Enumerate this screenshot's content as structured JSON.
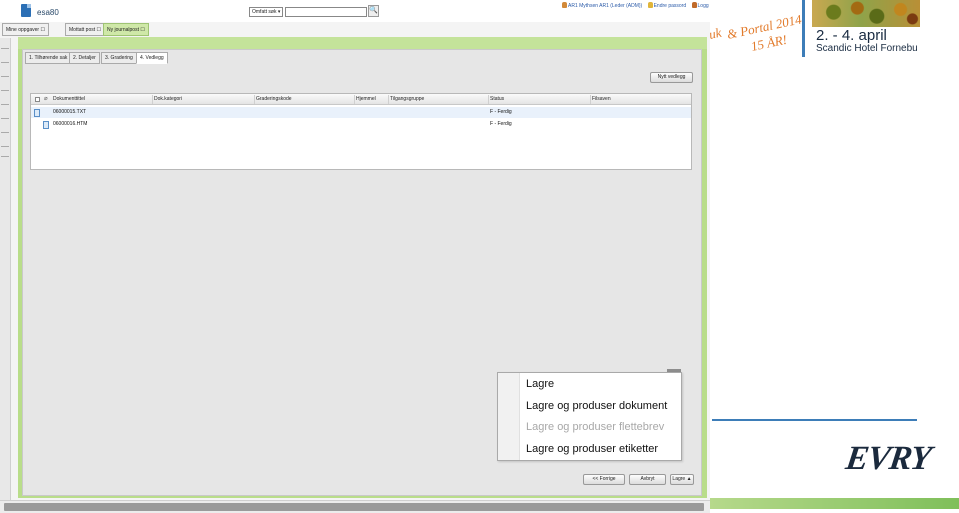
{
  "topbar": {
    "title": "esa80",
    "search_select": "Omfatt søk",
    "search_input": "",
    "search_button": "🔍",
    "user_name": "AR1 Mythsen AR1 (Leder (ADM))",
    "change_password": "Endre passord",
    "logout": "Logg ut"
  },
  "top_tabs": [
    {
      "label": "Mine oppgaver ☐"
    },
    {
      "label": "Mottatt post ☐"
    },
    {
      "label": "Ny journalpost ☐"
    }
  ],
  "sub_tabs": [
    {
      "label": "1. Tilhørende sak"
    },
    {
      "label": "2. Detaljer"
    },
    {
      "label": "3. Gradering"
    },
    {
      "label": "4. Vedlegg"
    }
  ],
  "new_attachment_label": "Nytt vedlegg",
  "grid": {
    "columns": [
      "Dokumenttittel",
      "Dok.kategori",
      "Graderingskode",
      "Hjemmel",
      "Tilgangsgruppe",
      "Status",
      "Filsaven"
    ],
    "rows": [
      {
        "title": "06000015.TXT",
        "status": "F - Ferdig"
      },
      {
        "title": "06000016.HTM",
        "status": "F - Ferdig"
      }
    ]
  },
  "save_menu": {
    "items": [
      {
        "label": "Lagre",
        "enabled": true
      },
      {
        "label": "Lagre og produser dokument",
        "enabled": true
      },
      {
        "label": "Lagre og produser flettebrev",
        "enabled": false
      },
      {
        "label": "Lagre og produser etiketter",
        "enabled": true
      }
    ]
  },
  "bottom_buttons": {
    "previous": "<< Forrige",
    "cancel": "Avbryt",
    "save": "Lagre ▲"
  },
  "promo": {
    "script_text": "& Portal 2014",
    "script_text_2": "15 ÅR!",
    "script_prefix": "uk",
    "date": "2. - 4. april",
    "venue": "Scandic Hotel Fornebu",
    "brand": "EVRY"
  },
  "colors": {
    "frame_green": "#b9dd8a",
    "accent_blue": "#3d7db8",
    "promo_orange": "#e27a2a"
  }
}
